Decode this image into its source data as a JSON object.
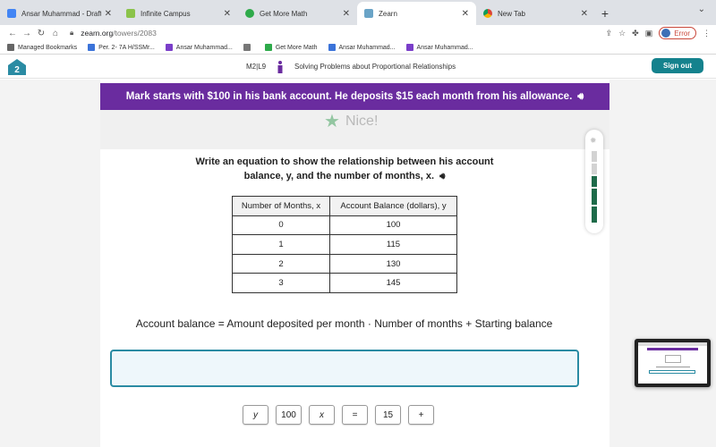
{
  "browser": {
    "tabs": [
      {
        "title": "Ansar Muhammad - Draft Even",
        "icon": "docs-icon",
        "active": false
      },
      {
        "title": "Infinite Campus",
        "icon": "infinite-campus-icon",
        "active": false
      },
      {
        "title": "Get More Math",
        "icon": "get-more-math-icon",
        "active": false
      },
      {
        "title": "Zearn",
        "icon": "zearn-icon",
        "active": true
      },
      {
        "title": "New Tab",
        "icon": "chrome-icon",
        "active": false
      }
    ],
    "url_host": "zearn.org",
    "url_path": "/towers/2083",
    "profile_status": "Error",
    "bookmarks": [
      {
        "label": "Managed Bookmarks",
        "icon": "folder-icon"
      },
      {
        "label": "Per. 2- 7A H/SSMr...",
        "icon": "classroom-icon"
      },
      {
        "label": "Ansar Muhammad...",
        "icon": "k-icon"
      },
      {
        "label": "",
        "icon": "globe-icon"
      },
      {
        "label": "Get More Math",
        "icon": "get-more-math-icon"
      },
      {
        "label": "Ansar Muhammad...",
        "icon": "docs-icon"
      },
      {
        "label": "Ansar Muhammad...",
        "icon": "k-icon"
      }
    ]
  },
  "header": {
    "lesson_code": "M2|L9",
    "lesson_title": "Solving Problems about Proportional Relationships",
    "sign_out": "Sign out"
  },
  "banner": {
    "text": "Mark starts with $100 in his bank account. He deposits $15 each month from his allowance."
  },
  "feedback": {
    "text": "Nice!"
  },
  "question": {
    "line1": "Write an equation to show the relationship between his account",
    "line2": "balance, y, and the number of months, x."
  },
  "table": {
    "headers": [
      "Number of Months, x",
      "Account Balance (dollars), y"
    ],
    "rows": [
      [
        "0",
        "100"
      ],
      [
        "1",
        "115"
      ],
      [
        "2",
        "130"
      ],
      [
        "3",
        "145"
      ]
    ]
  },
  "formula": {
    "text": "Account balance = Amount deposited per month  ·  Number of months + Starting balance"
  },
  "answer": {
    "value": ""
  },
  "tiles": [
    "y",
    "100",
    "x",
    "=",
    "15",
    "+"
  ],
  "colors": {
    "banner": "#6a2c9f",
    "accent": "#14828d",
    "progress_done": "#1e6b4a",
    "progress_todo": "#d3d3d3"
  }
}
